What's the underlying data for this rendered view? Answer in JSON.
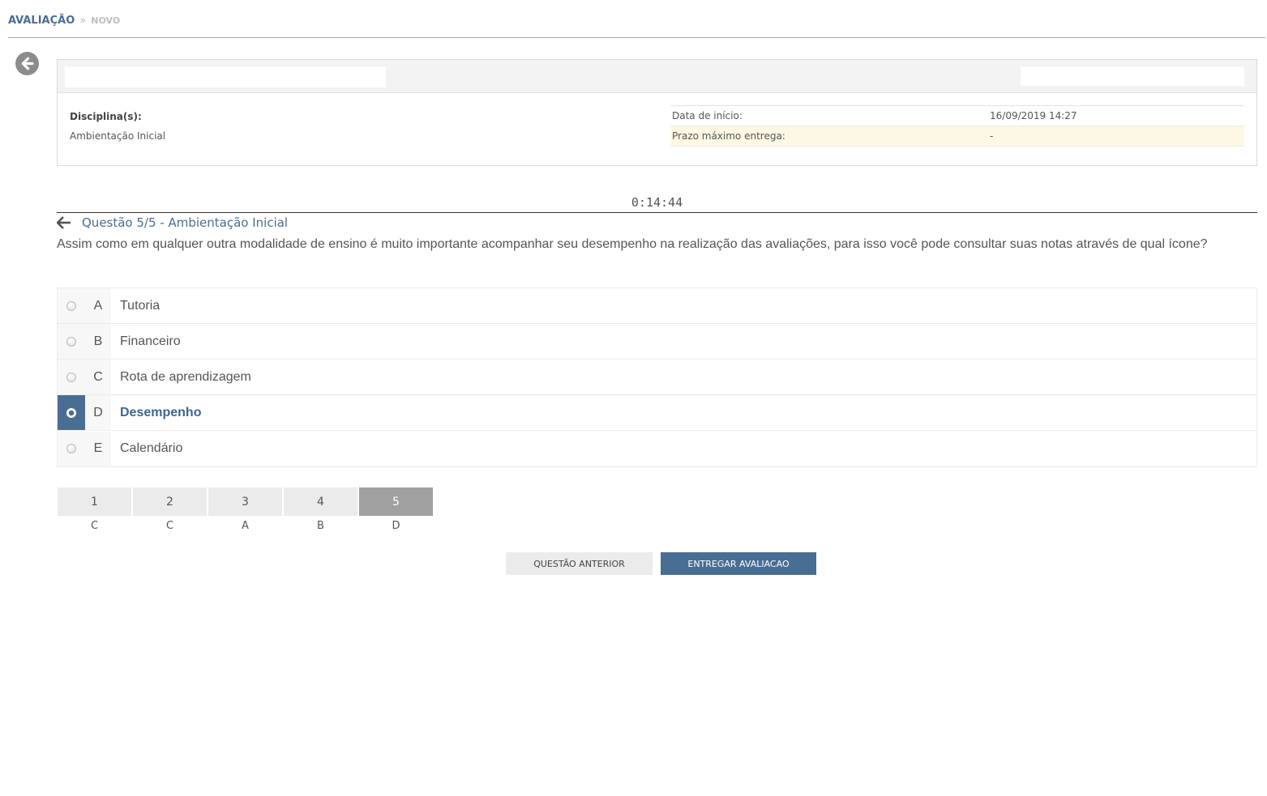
{
  "breadcrumb": {
    "root": "AVALIAÇÃO",
    "separator": "»",
    "current": "NOVO"
  },
  "icons": {
    "back_circle": "arrow-left-circle-icon",
    "question_back": "arrow-left-icon"
  },
  "info": {
    "discipline_label": "Disciplina(s):",
    "discipline_value": "Ambientação Inicial",
    "dates": [
      {
        "label": "Data de início:",
        "value": "16/09/2019 14:27"
      },
      {
        "label": "Prazo máximo entrega:",
        "value": "-"
      }
    ]
  },
  "timer": "0:14:44",
  "question": {
    "title": "Questão 5/5 - Ambientação Inicial",
    "text": "Assim como em qualquer outra modalidade de ensino é muito importante acompanhar seu desempenho na realização das avaliações, para isso você pode consultar suas notas através de qual ícone?",
    "options": [
      {
        "letter": "A",
        "text": "Tutoria"
      },
      {
        "letter": "B",
        "text": "Financeiro"
      },
      {
        "letter": "C",
        "text": "Rota de aprendizagem"
      },
      {
        "letter": "D",
        "text": "Desempenho"
      },
      {
        "letter": "E",
        "text": "Calendário"
      }
    ],
    "selected": "D"
  },
  "navigation": [
    {
      "num": "1",
      "answer": "C"
    },
    {
      "num": "2",
      "answer": "C"
    },
    {
      "num": "3",
      "answer": "A"
    },
    {
      "num": "4",
      "answer": "B"
    },
    {
      "num": "5",
      "answer": "D"
    }
  ],
  "current_question": "5",
  "buttons": {
    "previous": "QUESTÃO ANTERIOR",
    "submit": "ENTREGAR AVALIACAO"
  },
  "colors": {
    "accent": "#4a6d93",
    "highlight_row": "#fcf8e3",
    "current_nav": "#a0a0a0"
  }
}
